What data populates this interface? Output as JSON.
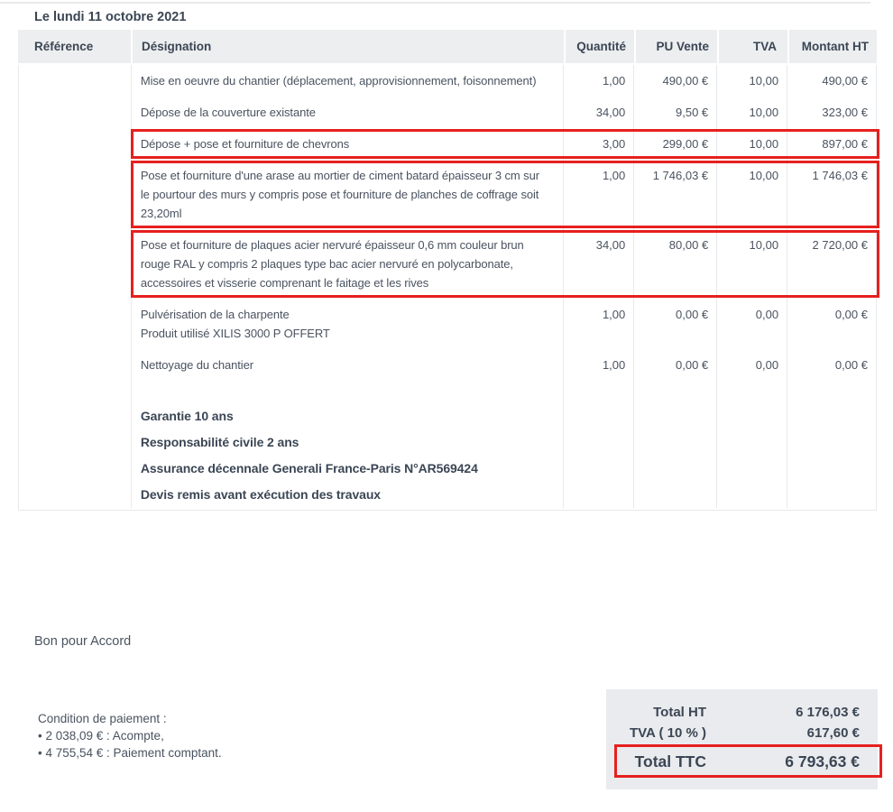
{
  "date_line": "Le lundi 11 octobre 2021",
  "table": {
    "headers": [
      "Référence",
      "Désignation",
      "Quantité",
      "PU Vente",
      "TVA",
      "Montant HT"
    ],
    "rows": [
      {
        "reference": "",
        "designation": "Mise en oeuvre du chantier (déplacement, approvisionnement, foisonnement)",
        "quantity": "1,00",
        "unit_price": "490,00 €",
        "tva": "10,00",
        "amount_ht": "490,00 €",
        "highlighted": false
      },
      {
        "reference": "",
        "designation": "Dépose de la couverture existante",
        "quantity": "34,00",
        "unit_price": "9,50 €",
        "tva": "10,00",
        "amount_ht": "323,00 €",
        "highlighted": false
      },
      {
        "reference": "",
        "designation": "Dépose + pose et fourniture de chevrons",
        "quantity": "3,00",
        "unit_price": "299,00 €",
        "tva": "10,00",
        "amount_ht": "897,00 €",
        "highlighted": true
      },
      {
        "reference": "",
        "designation": "Pose et fourniture d'une arase au mortier de ciment batard épaisseur 3 cm sur le pourtour des murs y compris pose et fourniture de planches de coffrage soit 23,20ml",
        "quantity": "1,00",
        "unit_price": "1 746,03 €",
        "tva": "10,00",
        "amount_ht": "1 746,03 €",
        "highlighted": true
      },
      {
        "reference": "",
        "designation": "Pose et fourniture de plaques acier nervuré épaisseur 0,6 mm couleur brun rouge RAL y compris 2 plaques type bac acier nervuré en polycarbonate, accessoires et visserie comprenant le faitage et les rives",
        "quantity": "34,00",
        "unit_price": "80,00 €",
        "tva": "10,00",
        "amount_ht": "2 720,00 €",
        "highlighted": true
      },
      {
        "reference": "",
        "designation": "Pulvérisation de la charpente\nProduit utilisé XILIS 3000 P OFFERT",
        "quantity": "1,00",
        "unit_price": "0,00 €",
        "tva": "0,00",
        "amount_ht": "0,00 €",
        "highlighted": false
      },
      {
        "reference": "",
        "designation": "Nettoyage du chantier",
        "quantity": "1,00",
        "unit_price": "0,00 €",
        "tva": "0,00",
        "amount_ht": "0,00 €",
        "highlighted": false
      }
    ],
    "notes": [
      "Garantie 10 ans",
      "Responsabilité civile 2 ans",
      "Assurance décennale Generali France-Paris N°AR569424",
      "Devis remis avant exécution des travaux"
    ]
  },
  "signature_label": "Bon pour Accord",
  "payment": {
    "title": "Condition de paiement :",
    "items": [
      "2 038,09 € : Acompte,",
      "4 755,54 € : Paiement comptant."
    ]
  },
  "totals": {
    "rows": [
      {
        "label": "Total HT",
        "value": "6 176,03 €",
        "emphasis": false
      },
      {
        "label": "TVA ( 10 % )",
        "value": "617,60 €",
        "emphasis": false
      },
      {
        "label": "Total TTC",
        "value": "6 793,63 €",
        "emphasis": true
      }
    ]
  },
  "colors": {
    "accent_red": "#e6201e",
    "header_bg": "#eceef0",
    "totals_bg": "#e9ebee"
  }
}
